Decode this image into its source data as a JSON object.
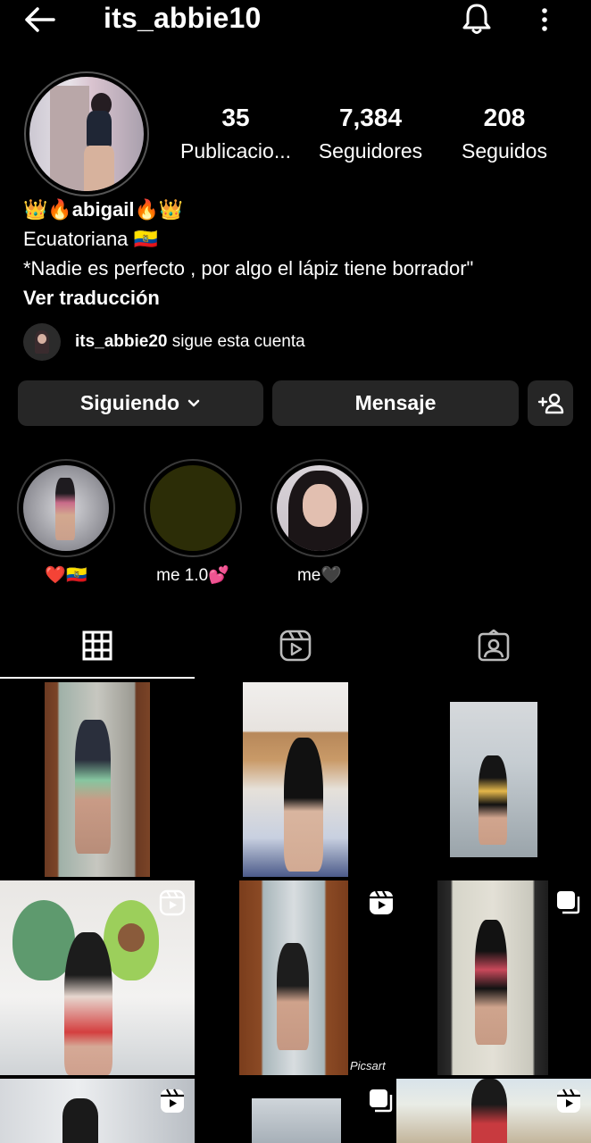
{
  "header": {
    "username": "its_abbie10",
    "back_icon": "arrow-left-icon",
    "bell_icon": "bell-icon",
    "menu_icon": "more-vertical-icon"
  },
  "stats": {
    "posts_count": "35",
    "posts_label": "Publicacio...",
    "followers_count": "7,384",
    "followers_label": "Seguidores",
    "following_count": "208",
    "following_label": "Seguidos"
  },
  "bio": {
    "name": "👑🔥abigail🔥👑",
    "line1": "Ecuatoriana 🇪🇨",
    "line2": "*Nadie es perfecto , por algo el lápiz tiene borrador\"",
    "translate": "Ver traducción"
  },
  "followed_by": {
    "username": "its_abbie20",
    "suffix": " sigue esta cuenta"
  },
  "buttons": {
    "following": "Siguiendo",
    "message": "Mensaje",
    "add_person_icon": "add-person-icon"
  },
  "highlights": [
    {
      "label": "❤️🇪🇨"
    },
    {
      "label": "me 1.0💕"
    },
    {
      "label": "me🖤"
    }
  ],
  "tabs": [
    {
      "icon": "grid-icon",
      "active": true
    },
    {
      "icon": "reels-icon",
      "active": false
    },
    {
      "icon": "tagged-icon",
      "active": false
    }
  ],
  "grid_overlay_text": "Picsart",
  "colors": {
    "background": "#000000",
    "button": "#262626",
    "text": "#ffffff"
  }
}
